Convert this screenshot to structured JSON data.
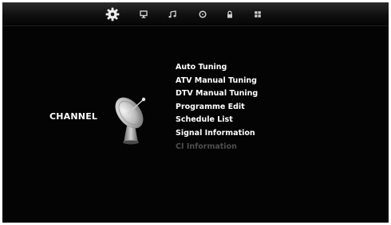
{
  "header": {
    "tabs": [
      {
        "icon": "gear-icon",
        "active": true
      },
      {
        "icon": "monitor-icon",
        "active": false
      },
      {
        "icon": "music-note-icon",
        "active": false
      },
      {
        "icon": "clock-icon",
        "active": false
      },
      {
        "icon": "lock-icon",
        "active": false
      },
      {
        "icon": "grid-icon",
        "active": false
      }
    ]
  },
  "page": {
    "section_title": "CHANNEL",
    "section_icon": "satellite-dish-icon"
  },
  "menu": {
    "items": [
      {
        "label": "Auto Tuning",
        "enabled": true
      },
      {
        "label": "ATV Manual Tuning",
        "enabled": true
      },
      {
        "label": "DTV Manual Tuning",
        "enabled": true
      },
      {
        "label": "Programme Edit",
        "enabled": true
      },
      {
        "label": "Schedule List",
        "enabled": true
      },
      {
        "label": "Signal Information",
        "enabled": true
      },
      {
        "label": "CI Information",
        "enabled": false
      }
    ]
  },
  "colors": {
    "background": "#040404",
    "text": "#ffffff",
    "disabled_text": "#4e4e4e"
  }
}
